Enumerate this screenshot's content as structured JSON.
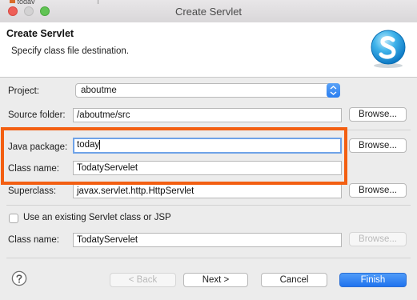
{
  "background_tab": {
    "label": "today"
  },
  "window": {
    "title": "Create Servlet"
  },
  "header": {
    "title": "Create Servlet",
    "description": "Specify class file destination."
  },
  "form": {
    "project": {
      "label": "Project:",
      "value": "aboutme"
    },
    "source_folder": {
      "label": "Source folder:",
      "value": "/aboutme/src",
      "button": "Browse..."
    },
    "java_package": {
      "label": "Java package:",
      "value": "today",
      "button": "Browse..."
    },
    "class_name": {
      "label": "Class name:",
      "value": "TodatyServelet"
    },
    "superclass": {
      "label": "Superclass:",
      "value": "javax.servlet.http.HttpServlet",
      "button": "Browse..."
    },
    "use_existing": {
      "label": "Use an existing Servlet class or JSP",
      "checked": false
    },
    "existing_class_name": {
      "label": "Class name:",
      "value": "TodatyServelet",
      "button": "Browse..."
    }
  },
  "footer": {
    "back": "< Back",
    "next": "Next >",
    "cancel": "Cancel",
    "finish": "Finish"
  },
  "colors": {
    "highlight": "#f35f12",
    "primary_button": "#2a7ef0",
    "focus_ring": "#6fa3e8"
  },
  "icons": {
    "logo": "servlet-logo-icon",
    "help": "help-icon",
    "select_arrows": "up-down-arrows-icon"
  }
}
